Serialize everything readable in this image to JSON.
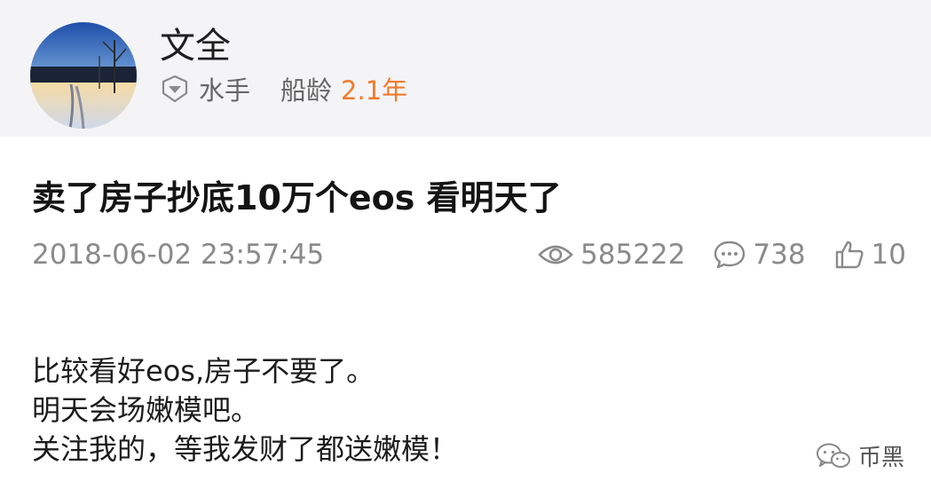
{
  "user": {
    "name": "文全",
    "rank": "水手",
    "age_label": "船龄",
    "age_value": "2.1年"
  },
  "post": {
    "title": "卖了房子抄底10万个eos 看明天了",
    "time": "2018-06-02 23:57:45",
    "stats": {
      "views": "585222",
      "comments": "738",
      "likes": "10"
    },
    "body_lines": [
      "比较看好eos,房子不要了。",
      "明天会场嫩模吧。",
      "关注我的，等我发财了都送嫩模！"
    ]
  },
  "watermark": "币黑",
  "colors": {
    "accent": "#f07a2c",
    "header_bg": "#f4f4f6",
    "muted_text": "#8a8a8a"
  },
  "icons": [
    "diamond-icon",
    "eye-icon",
    "comment-icon",
    "thumbs-up-icon",
    "wechat-icon"
  ]
}
